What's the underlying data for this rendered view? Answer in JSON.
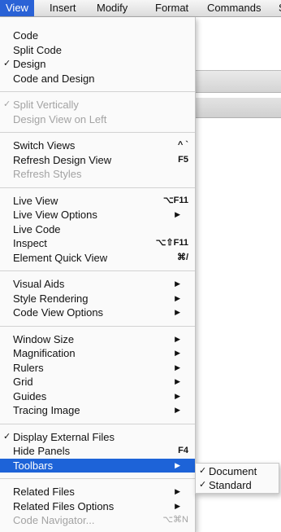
{
  "menubar": {
    "items": [
      "View",
      "Insert",
      "Modify",
      "Format",
      "Commands",
      "S"
    ]
  },
  "menu": {
    "groups": [
      [
        {
          "label": "Code"
        },
        {
          "label": "Split Code"
        },
        {
          "label": "Design",
          "checked": true
        },
        {
          "label": "Code and Design"
        }
      ],
      [
        {
          "label": "Split Vertically",
          "checked": true,
          "disabled": true
        },
        {
          "label": "Design View on Left",
          "disabled": true
        }
      ],
      [
        {
          "label": "Switch Views",
          "shortcut": "^ `"
        },
        {
          "label": "Refresh Design View",
          "shortcut": "F5"
        },
        {
          "label": "Refresh Styles",
          "disabled": true
        }
      ],
      [
        {
          "label": "Live View",
          "shortcut": "⌥F11"
        },
        {
          "label": "Live View Options",
          "submenu": true
        },
        {
          "label": "Live Code"
        },
        {
          "label": "Inspect",
          "shortcut": "⌥⇧F11"
        },
        {
          "label": "Element Quick View",
          "shortcut": "⌘/"
        }
      ],
      [
        {
          "label": "Visual Aids",
          "submenu": true
        },
        {
          "label": "Style Rendering",
          "submenu": true
        },
        {
          "label": "Code View Options",
          "submenu": true
        }
      ],
      [
        {
          "label": "Window Size",
          "submenu": true
        },
        {
          "label": "Magnification",
          "submenu": true
        },
        {
          "label": "Rulers",
          "submenu": true
        },
        {
          "label": "Grid",
          "submenu": true
        },
        {
          "label": "Guides",
          "submenu": true
        },
        {
          "label": "Tracing Image",
          "submenu": true
        }
      ],
      [
        {
          "label": "Display External Files",
          "checked": true
        },
        {
          "label": "Hide Panels",
          "shortcut": "F4"
        },
        {
          "label": "Toolbars",
          "submenu": true,
          "selected": true
        }
      ],
      [
        {
          "label": "Related Files",
          "submenu": true
        },
        {
          "label": "Related Files Options",
          "submenu": true
        },
        {
          "label": "Code Navigator...",
          "shortcut": "⌥⌘N",
          "disabled": true
        }
      ]
    ]
  },
  "submenu_toolbars": {
    "items": [
      {
        "label": "Document",
        "checked": true
      },
      {
        "label": "Standard",
        "checked": true
      }
    ]
  },
  "glyphs": {
    "check": "✓",
    "arrow": "▶"
  },
  "colors": {
    "highlight": "#1d63d8",
    "disabled_text": "#a3a3a3"
  }
}
